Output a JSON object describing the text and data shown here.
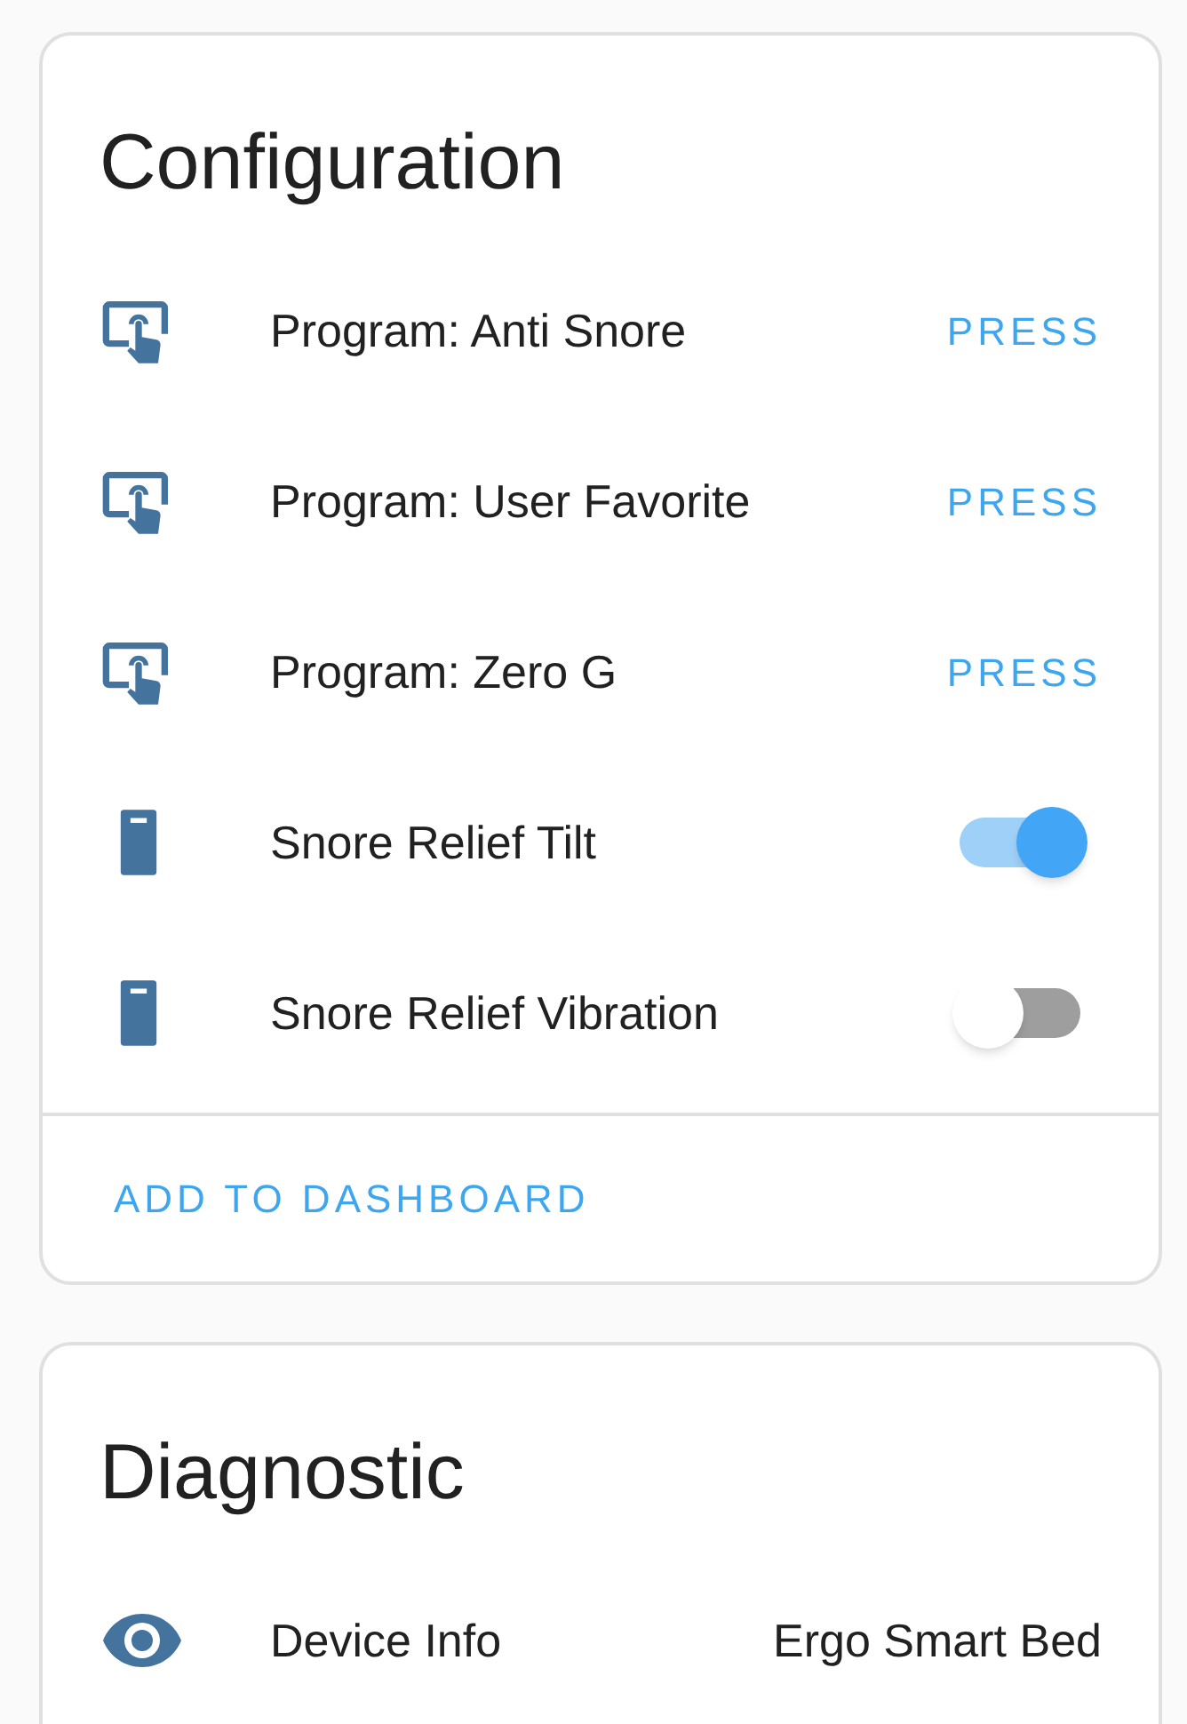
{
  "cards": [
    {
      "title": "Configuration",
      "rows": [
        {
          "kind": "button",
          "label": "Program: Anti Snore",
          "action": "PRESS"
        },
        {
          "kind": "button",
          "label": "Program: User Favorite",
          "action": "PRESS"
        },
        {
          "kind": "button",
          "label": "Program: Zero G",
          "action": "PRESS"
        },
        {
          "kind": "switch",
          "label": "Snore Relief Tilt",
          "on": true
        },
        {
          "kind": "switch",
          "label": "Snore Relief Vibration",
          "on": false
        }
      ],
      "footer_action": "ADD TO DASHBOARD"
    },
    {
      "title": "Diagnostic",
      "rows": [
        {
          "kind": "info",
          "label": "Device Info",
          "value": "Ergo Smart Bed"
        }
      ]
    }
  ]
}
